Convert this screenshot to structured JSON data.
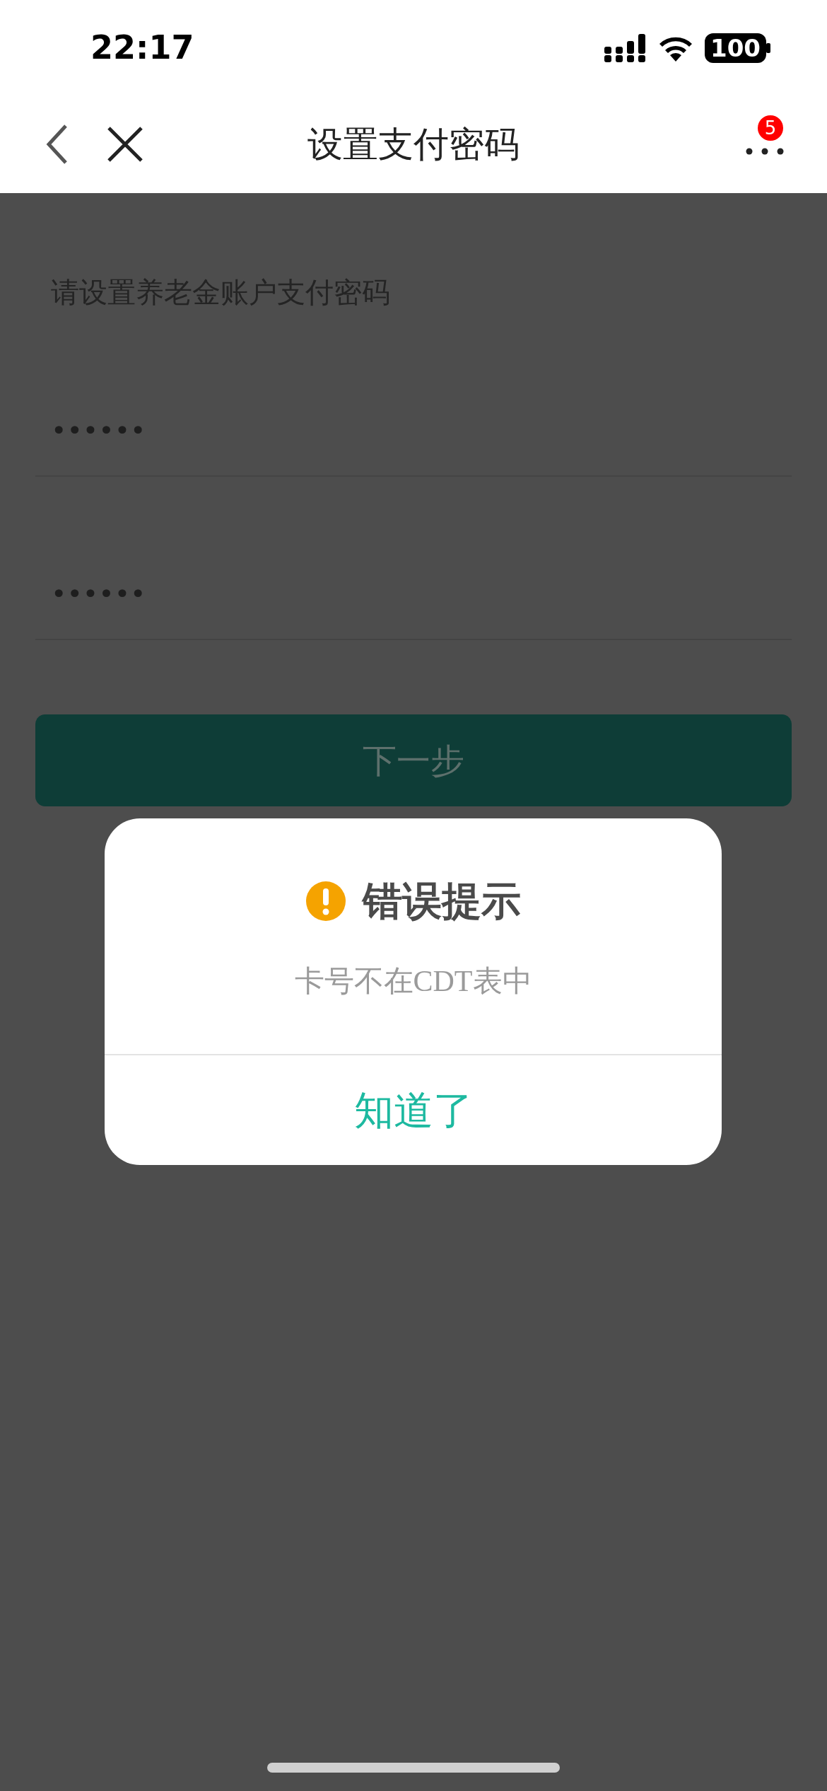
{
  "status_bar": {
    "time": "22:17",
    "battery": "100"
  },
  "nav_bar": {
    "title": "设置支付密码",
    "badge": "5"
  },
  "form": {
    "label": "请设置养老金账户支付密码",
    "fields": [
      {
        "value": "••••••"
      },
      {
        "value": "••••••"
      }
    ],
    "next_button": "下一步"
  },
  "dialog": {
    "title": "错误提示",
    "message": "卡号不在CDT表中",
    "button": "知道了"
  }
}
